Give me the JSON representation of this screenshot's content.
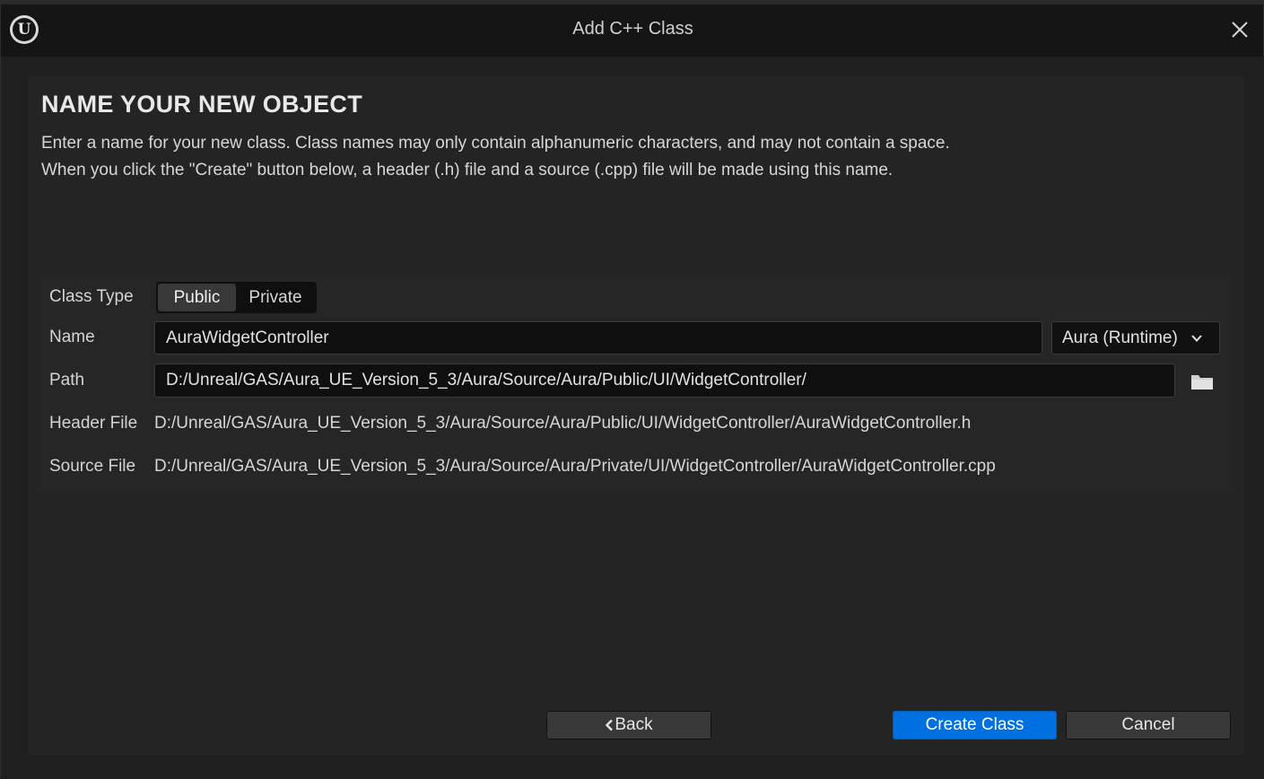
{
  "window": {
    "title": "Add C++ Class",
    "logo_letter": "U"
  },
  "page": {
    "heading": "NAME YOUR NEW OBJECT",
    "description_line1": "Enter a name for your new class. Class names may only contain alphanumeric characters, and may not contain a space.",
    "description_line2": "When you click the \"Create\" button below, a header (.h) file and a source (.cpp) file will be made using this name."
  },
  "form": {
    "class_type_label": "Class Type",
    "class_type_options": [
      "Public",
      "Private"
    ],
    "class_type_selected": "Public",
    "name_label": "Name",
    "name_value": "AuraWidgetController",
    "module_selected": "Aura (Runtime)",
    "path_label": "Path",
    "path_value": "D:/Unreal/GAS/Aura_UE_Version_5_3/Aura/Source/Aura/Public/UI/WidgetController/",
    "header_file_label": "Header File",
    "header_file_value": "D:/Unreal/GAS/Aura_UE_Version_5_3/Aura/Source/Aura/Public/UI/WidgetController/AuraWidgetController.h",
    "source_file_label": "Source File",
    "source_file_value": "D:/Unreal/GAS/Aura_UE_Version_5_3/Aura/Source/Aura/Private/UI/WidgetController/AuraWidgetController.cpp"
  },
  "buttons": {
    "back": "Back",
    "create": "Create Class",
    "cancel": "Cancel"
  },
  "icons": {
    "logo": "unreal-logo-icon",
    "close": "close-icon",
    "chevron": "chevron-down-icon",
    "folder": "folder-icon",
    "back": "chevron-left-icon"
  },
  "colors": {
    "accent": "#0070e0",
    "background": "#151515",
    "panel": "#242424"
  }
}
